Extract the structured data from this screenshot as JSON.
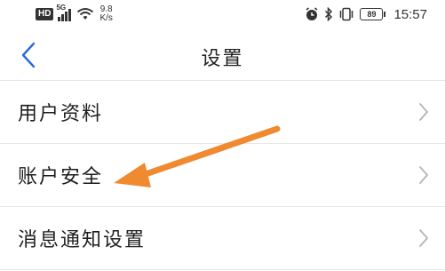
{
  "status_bar": {
    "network_badge": "HD",
    "signal_tag": "5G",
    "speed_value": "9.8",
    "speed_unit": "K/s",
    "battery_level": "89",
    "time": "15:57",
    "icons": [
      "alarm-icon",
      "bluetooth-icon",
      "vibrate-icon",
      "battery-icon",
      "wifi-icon",
      "signal-icon"
    ]
  },
  "nav": {
    "back_icon": "chevron-left-icon",
    "title": "设置"
  },
  "settings": {
    "items": [
      {
        "label": "用户资料"
      },
      {
        "label": "账户安全"
      },
      {
        "label": "消息通知设置"
      }
    ]
  },
  "colors": {
    "accent": "#2a6bd8",
    "arrow_annotation": "#f08a30",
    "divider": "#e8e8e8",
    "chevron": "#b5b5b5"
  }
}
